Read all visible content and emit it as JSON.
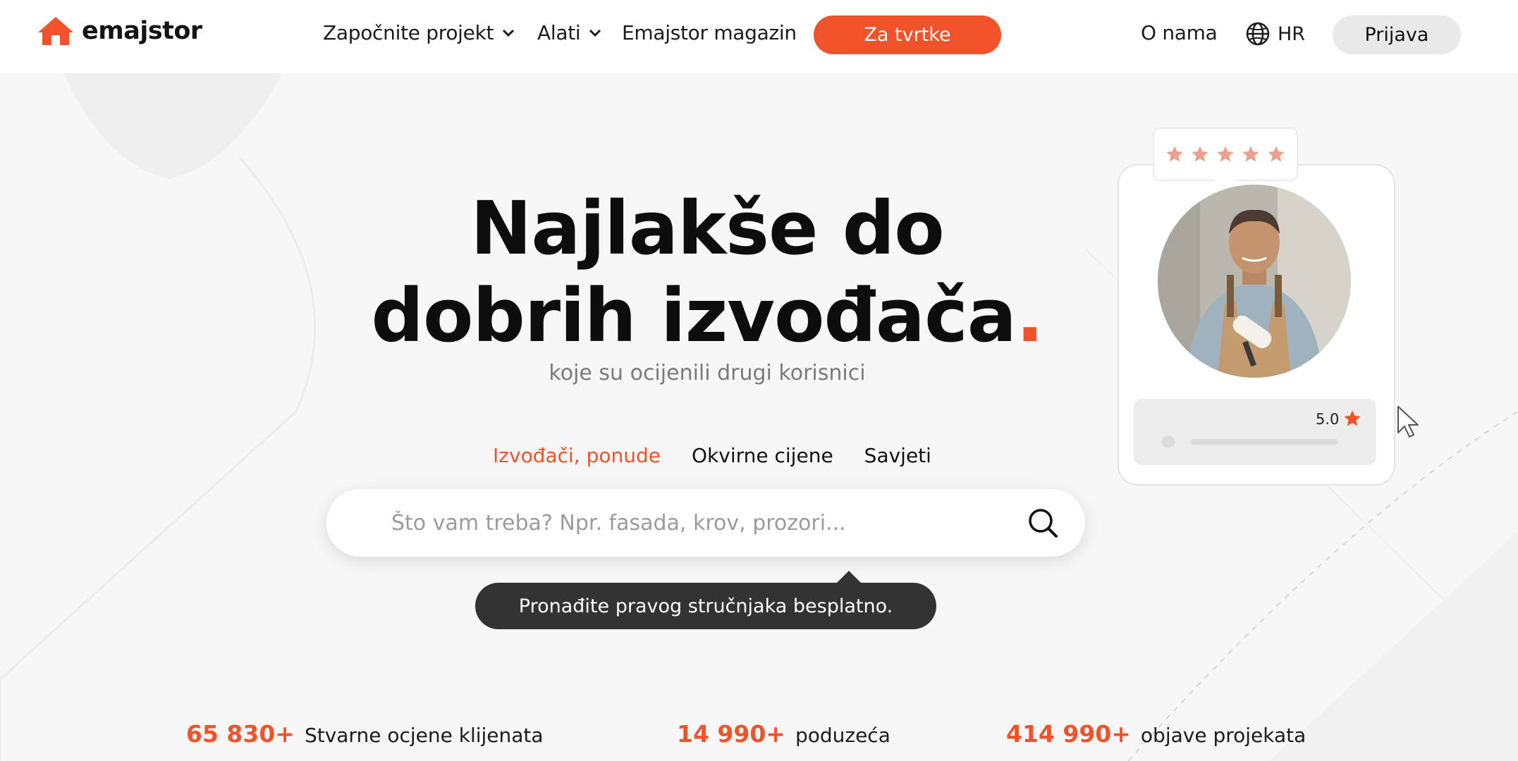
{
  "brand": {
    "name": "emajstor",
    "accent": "#f0532a"
  },
  "nav": {
    "items": [
      {
        "label": "Započnite projekt",
        "dropdown": true
      },
      {
        "label": "Alati",
        "dropdown": true
      },
      {
        "label": "Emajstor magazin",
        "dropdown": false
      }
    ],
    "cta_label": "Za tvrtke",
    "about_label": "O nama",
    "language": "HR",
    "login_label": "Prijava"
  },
  "hero": {
    "title_line1": "Najlakše do",
    "title_line2": "dobrih izvođača",
    "title_dot": ".",
    "subtitle": "koje su ocijenili drugi korisnici"
  },
  "tabs": [
    {
      "label": "Izvođači, ponude",
      "active": true
    },
    {
      "label": "Okvirne cijene",
      "active": false
    },
    {
      "label": "Savjeti",
      "active": false
    }
  ],
  "search": {
    "placeholder": "Što vam treba? Npr. fasada, krov, prozori...",
    "value": ""
  },
  "tooltip": "Pronađite pravog stručnjaka besplatno.",
  "profile_card": {
    "star_count": 5,
    "rating": "5.0"
  },
  "stats": [
    {
      "number": "65 830+",
      "label": "Stvarne ocjene klijenata"
    },
    {
      "number": "14 990+",
      "label": "poduzeća"
    },
    {
      "number": "414 990+",
      "label": "objave projekata"
    }
  ]
}
